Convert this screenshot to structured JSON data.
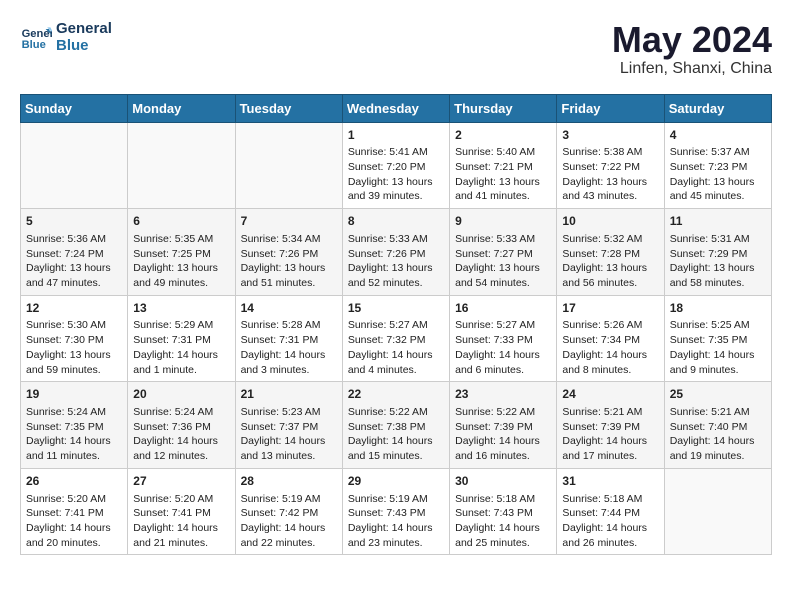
{
  "logo": {
    "line1": "General",
    "line2": "Blue"
  },
  "title": "May 2024",
  "location": "Linfen, Shanxi, China",
  "days_header": [
    "Sunday",
    "Monday",
    "Tuesday",
    "Wednesday",
    "Thursday",
    "Friday",
    "Saturday"
  ],
  "weeks": [
    [
      {
        "day": "",
        "info": ""
      },
      {
        "day": "",
        "info": ""
      },
      {
        "day": "",
        "info": ""
      },
      {
        "day": "1",
        "info": "Sunrise: 5:41 AM\nSunset: 7:20 PM\nDaylight: 13 hours and 39 minutes."
      },
      {
        "day": "2",
        "info": "Sunrise: 5:40 AM\nSunset: 7:21 PM\nDaylight: 13 hours and 41 minutes."
      },
      {
        "day": "3",
        "info": "Sunrise: 5:38 AM\nSunset: 7:22 PM\nDaylight: 13 hours and 43 minutes."
      },
      {
        "day": "4",
        "info": "Sunrise: 5:37 AM\nSunset: 7:23 PM\nDaylight: 13 hours and 45 minutes."
      }
    ],
    [
      {
        "day": "5",
        "info": "Sunrise: 5:36 AM\nSunset: 7:24 PM\nDaylight: 13 hours and 47 minutes."
      },
      {
        "day": "6",
        "info": "Sunrise: 5:35 AM\nSunset: 7:25 PM\nDaylight: 13 hours and 49 minutes."
      },
      {
        "day": "7",
        "info": "Sunrise: 5:34 AM\nSunset: 7:26 PM\nDaylight: 13 hours and 51 minutes."
      },
      {
        "day": "8",
        "info": "Sunrise: 5:33 AM\nSunset: 7:26 PM\nDaylight: 13 hours and 52 minutes."
      },
      {
        "day": "9",
        "info": "Sunrise: 5:33 AM\nSunset: 7:27 PM\nDaylight: 13 hours and 54 minutes."
      },
      {
        "day": "10",
        "info": "Sunrise: 5:32 AM\nSunset: 7:28 PM\nDaylight: 13 hours and 56 minutes."
      },
      {
        "day": "11",
        "info": "Sunrise: 5:31 AM\nSunset: 7:29 PM\nDaylight: 13 hours and 58 minutes."
      }
    ],
    [
      {
        "day": "12",
        "info": "Sunrise: 5:30 AM\nSunset: 7:30 PM\nDaylight: 13 hours and 59 minutes."
      },
      {
        "day": "13",
        "info": "Sunrise: 5:29 AM\nSunset: 7:31 PM\nDaylight: 14 hours and 1 minute."
      },
      {
        "day": "14",
        "info": "Sunrise: 5:28 AM\nSunset: 7:31 PM\nDaylight: 14 hours and 3 minutes."
      },
      {
        "day": "15",
        "info": "Sunrise: 5:27 AM\nSunset: 7:32 PM\nDaylight: 14 hours and 4 minutes."
      },
      {
        "day": "16",
        "info": "Sunrise: 5:27 AM\nSunset: 7:33 PM\nDaylight: 14 hours and 6 minutes."
      },
      {
        "day": "17",
        "info": "Sunrise: 5:26 AM\nSunset: 7:34 PM\nDaylight: 14 hours and 8 minutes."
      },
      {
        "day": "18",
        "info": "Sunrise: 5:25 AM\nSunset: 7:35 PM\nDaylight: 14 hours and 9 minutes."
      }
    ],
    [
      {
        "day": "19",
        "info": "Sunrise: 5:24 AM\nSunset: 7:35 PM\nDaylight: 14 hours and 11 minutes."
      },
      {
        "day": "20",
        "info": "Sunrise: 5:24 AM\nSunset: 7:36 PM\nDaylight: 14 hours and 12 minutes."
      },
      {
        "day": "21",
        "info": "Sunrise: 5:23 AM\nSunset: 7:37 PM\nDaylight: 14 hours and 13 minutes."
      },
      {
        "day": "22",
        "info": "Sunrise: 5:22 AM\nSunset: 7:38 PM\nDaylight: 14 hours and 15 minutes."
      },
      {
        "day": "23",
        "info": "Sunrise: 5:22 AM\nSunset: 7:39 PM\nDaylight: 14 hours and 16 minutes."
      },
      {
        "day": "24",
        "info": "Sunrise: 5:21 AM\nSunset: 7:39 PM\nDaylight: 14 hours and 17 minutes."
      },
      {
        "day": "25",
        "info": "Sunrise: 5:21 AM\nSunset: 7:40 PM\nDaylight: 14 hours and 19 minutes."
      }
    ],
    [
      {
        "day": "26",
        "info": "Sunrise: 5:20 AM\nSunset: 7:41 PM\nDaylight: 14 hours and 20 minutes."
      },
      {
        "day": "27",
        "info": "Sunrise: 5:20 AM\nSunset: 7:41 PM\nDaylight: 14 hours and 21 minutes."
      },
      {
        "day": "28",
        "info": "Sunrise: 5:19 AM\nSunset: 7:42 PM\nDaylight: 14 hours and 22 minutes."
      },
      {
        "day": "29",
        "info": "Sunrise: 5:19 AM\nSunset: 7:43 PM\nDaylight: 14 hours and 23 minutes."
      },
      {
        "day": "30",
        "info": "Sunrise: 5:18 AM\nSunset: 7:43 PM\nDaylight: 14 hours and 25 minutes."
      },
      {
        "day": "31",
        "info": "Sunrise: 5:18 AM\nSunset: 7:44 PM\nDaylight: 14 hours and 26 minutes."
      },
      {
        "day": "",
        "info": ""
      }
    ]
  ]
}
